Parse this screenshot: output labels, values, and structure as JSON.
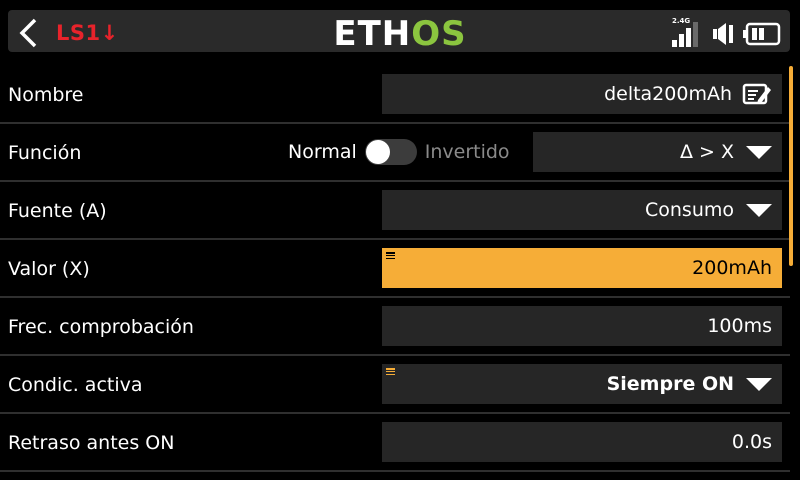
{
  "header": {
    "page_tag": "LS1↓",
    "logo_left": "ETH",
    "logo_right": "OS",
    "signal_label": "2.4G"
  },
  "rows": {
    "nombre": {
      "label": "Nombre",
      "value": "delta200mAh"
    },
    "funcion": {
      "label": "Función",
      "left_option": "Normal",
      "right_option": "Invertido",
      "toggle_on": false,
      "value": "Δ > X"
    },
    "fuente": {
      "label": "Fuente (A)",
      "value": "Consumo"
    },
    "valor": {
      "label": "Valor (X)",
      "value": "200mAh"
    },
    "frec": {
      "label": "Frec. comprobación",
      "value": "100ms"
    },
    "condic": {
      "label": "Condic. activa",
      "value": "Siempre ON"
    },
    "retraso": {
      "label": "Retraso antes ON",
      "value": "0.0s"
    }
  },
  "colors": {
    "accent": "#f6ad37",
    "logo_green": "#8bc53f",
    "tag_red": "#e8232b"
  },
  "icons": [
    "back-icon",
    "edit-icon",
    "dropdown-arrow-icon",
    "signal-icon",
    "speaker-icon",
    "battery-icon",
    "menu-indicator-icon"
  ]
}
